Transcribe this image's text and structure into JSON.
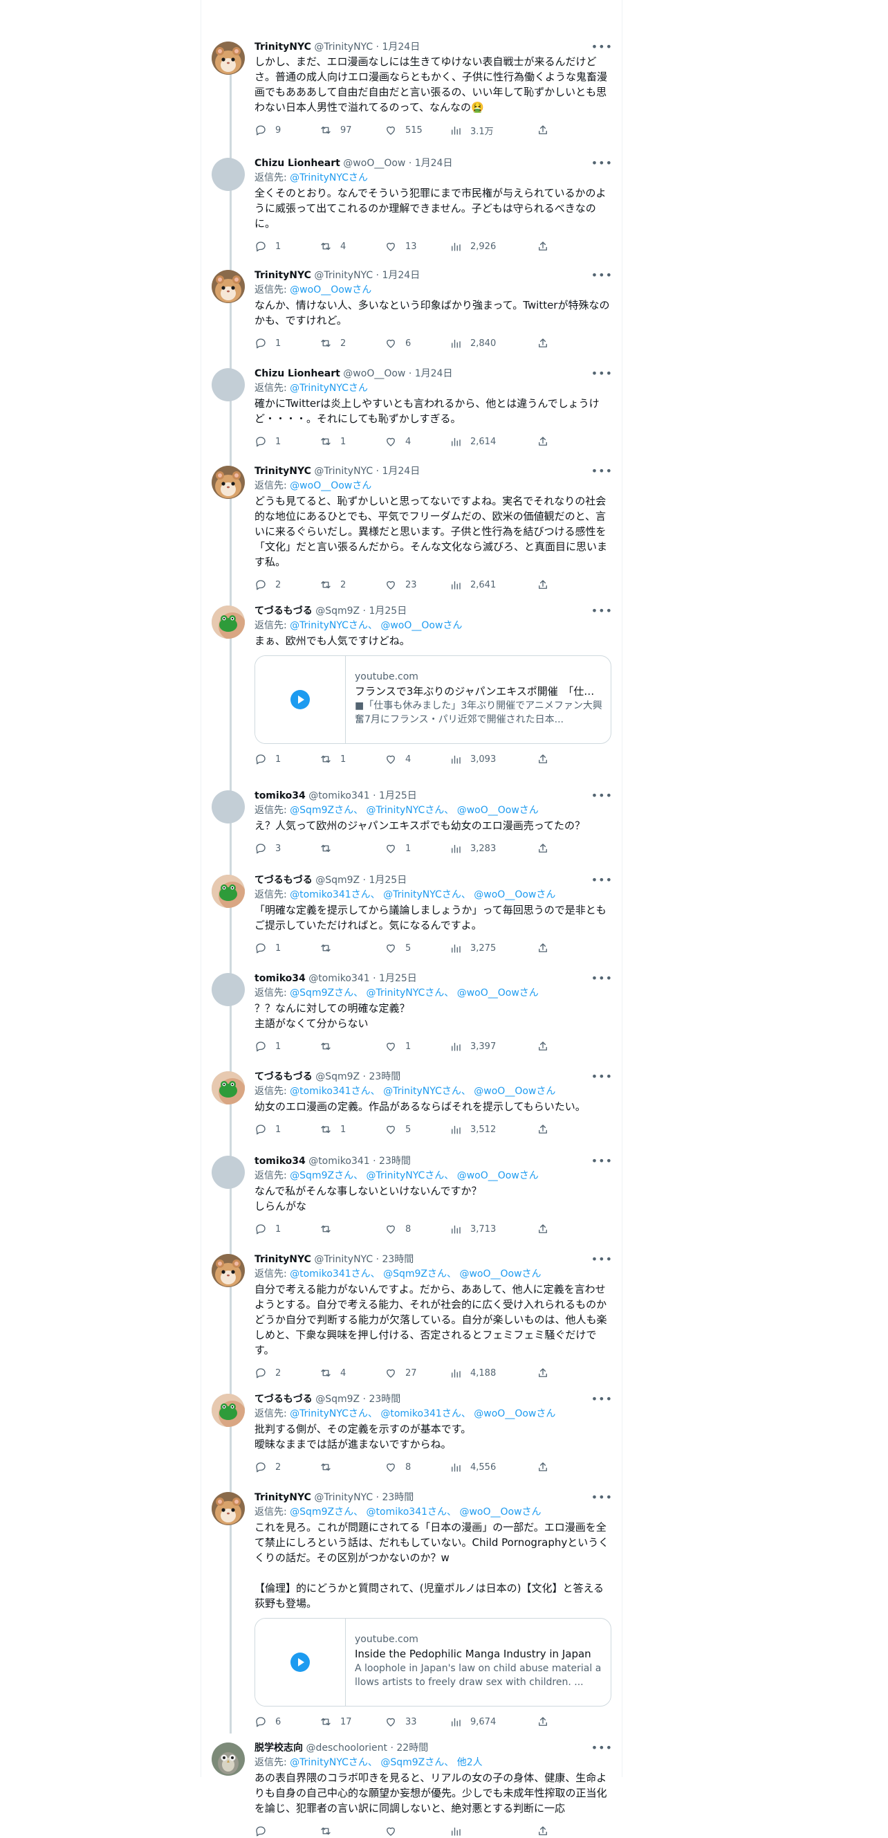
{
  "tweets": [
    {
      "name": "TrinityNYC",
      "handle": "@TrinityNYC",
      "time": "1月24日",
      "avatar": "hamster-avatar",
      "reply_to": [],
      "body": "しかし、まだ、エロ漫画なしには生きてゆけない表自戦士が来るんだけどさ。普通の成人向けエロ漫画ならともかく、子供に性行為働くような鬼畜漫画でもあああして自由だ自由だと言い張るの、いい年して恥ずかしいとも思わない日本人男性で溢れてるのって、なんなの🤮",
      "replies": "9",
      "retweets": "97",
      "likes": "515",
      "views": "3.1万"
    },
    {
      "name": "Chizu Lionheart",
      "handle": "@woO__Oow",
      "time": "1月24日",
      "avatar": "default-avatar",
      "reply_to": [
        "@TrinityNYCさん"
      ],
      "body": "全くそのとおり。なんでそういう犯罪にまで市民権が与えられているかのように威張って出てこれるのか理解できません。子どもは守られるべきなのに。",
      "replies": "1",
      "retweets": "4",
      "likes": "13",
      "views": "2,926"
    },
    {
      "name": "TrinityNYC",
      "handle": "@TrinityNYC",
      "time": "1月24日",
      "avatar": "hamster-avatar",
      "reply_to": [
        "@woO__Oowさん"
      ],
      "body": "なんか、情けない人、多いなという印象ばかり強まって。Twitterが特殊なのかも、ですけれど。",
      "replies": "1",
      "retweets": "2",
      "likes": "6",
      "views": "2,840"
    },
    {
      "name": "Chizu Lionheart",
      "handle": "@woO__Oow",
      "time": "1月24日",
      "avatar": "default-avatar",
      "reply_to": [
        "@TrinityNYCさん"
      ],
      "body": "確かにTwitterは炎上しやすいとも言われるから、他とは違うんでしょうけど・・・・。それにしても恥ずかしすぎる。",
      "replies": "1",
      "retweets": "1",
      "likes": "4",
      "views": "2,614"
    },
    {
      "name": "TrinityNYC",
      "handle": "@TrinityNYC",
      "time": "1月24日",
      "avatar": "hamster-avatar",
      "reply_to": [
        "@woO__Oowさん"
      ],
      "body": "どうも見てると、恥ずかしいと思ってないですよね。実名でそれなりの社会的な地位にあるひとでも、平気でフリーダムだの、欧米の価値観だのと、言いに来るぐらいだし。異様だと思います。子供と性行為を結びつける感性を「文化」だと言い張るんだから。そんな文化なら滅びろ、と真面目に思います私。",
      "replies": "2",
      "retweets": "2",
      "likes": "23",
      "views": "2,641"
    },
    {
      "name": "てづるもづる",
      "handle": "@Sqm9Z",
      "time": "1月25日",
      "avatar": "frog-avatar",
      "reply_to": [
        "@TrinityNYCさん、",
        "@woO__Oowさん"
      ],
      "body": "まぁ、欧州でも人気ですけどね。",
      "card": {
        "domain": "youtube.com",
        "title": "フランスで3年ぶりのジャパンエキスポ開催　「仕…",
        "desc": "■「仕事も休みました」3年ぶり開催でアニメファン大興奮7月にフランス・パリ近郊で開催された日本..."
      },
      "replies": "1",
      "retweets": "1",
      "likes": "4",
      "views": "3,093"
    },
    {
      "name": "tomiko34",
      "handle": "@tomiko341",
      "time": "1月25日",
      "avatar": "default-avatar",
      "reply_to": [
        "@Sqm9Zさん、",
        "@TrinityNYCさん、",
        "@woO__Oowさん"
      ],
      "body": "え？人気って欧州のジャパンエキスポでも幼女のエロ漫画売ってたの？",
      "replies": "3",
      "retweets": "",
      "likes": "1",
      "views": "3,283"
    },
    {
      "name": "てづるもづる",
      "handle": "@Sqm9Z",
      "time": "1月25日",
      "avatar": "frog-avatar",
      "reply_to": [
        "@tomiko341さん、",
        "@TrinityNYCさん、",
        "@woO__Oowさん"
      ],
      "body": "「明確な定義を提示してから議論しましょうか」って毎回思うので是非ともご提示していただければと。気になるんですよ。",
      "replies": "1",
      "retweets": "",
      "likes": "5",
      "views": "3,275"
    },
    {
      "name": "tomiko34",
      "handle": "@tomiko341",
      "time": "1月25日",
      "avatar": "default-avatar",
      "reply_to": [
        "@Sqm9Zさん、",
        "@TrinityNYCさん、",
        "@woO__Oowさん"
      ],
      "body": "？？なんに対しての明確な定義？\n主語がなくて分からない",
      "replies": "1",
      "retweets": "",
      "likes": "1",
      "views": "3,397"
    },
    {
      "name": "てづるもづる",
      "handle": "@Sqm9Z",
      "time": "23時間",
      "avatar": "frog-avatar",
      "reply_to": [
        "@tomiko341さん、",
        "@TrinityNYCさん、",
        "@woO__Oowさん"
      ],
      "body": "幼女のエロ漫画の定義。作品があるならばそれを提示してもらいたい。",
      "replies": "1",
      "retweets": "1",
      "likes": "5",
      "views": "3,512"
    },
    {
      "name": "tomiko34",
      "handle": "@tomiko341",
      "time": "23時間",
      "avatar": "default-avatar",
      "reply_to": [
        "@Sqm9Zさん、",
        "@TrinityNYCさん、",
        "@woO__Oowさん"
      ],
      "body": "なんで私がそんな事しないといけないんですか？\nしらんがな",
      "replies": "1",
      "retweets": "",
      "likes": "8",
      "views": "3,713"
    },
    {
      "name": "TrinityNYC",
      "handle": "@TrinityNYC",
      "time": "23時間",
      "avatar": "hamster-avatar",
      "reply_to": [
        "@tomiko341さん、",
        "@Sqm9Zさん、",
        "@woO__Oowさん"
      ],
      "body": "自分で考える能力がないんですよ。だから、ああして、他人に定義を言わせようとする。自分で考える能力、それが社会的に広く受け入れられるものかどうか自分で判断する能力が欠落している。自分が楽しいものは、他人も楽しめと、下衆な興味を押し付ける、否定されるとフェミフェミ騒ぐだけです。",
      "replies": "2",
      "retweets": "4",
      "likes": "27",
      "views": "4,188"
    },
    {
      "name": "てづるもづる",
      "handle": "@Sqm9Z",
      "time": "23時間",
      "avatar": "frog-avatar",
      "reply_to": [
        "@TrinityNYCさん、",
        "@tomiko341さん、",
        "@woO__Oowさん"
      ],
      "body": "批判する側が、その定義を示すのが基本です。\n曖昧なままでは話が進まないですからね。",
      "replies": "2",
      "retweets": "",
      "likes": "8",
      "views": "4,556"
    },
    {
      "name": "TrinityNYC",
      "handle": "@TrinityNYC",
      "time": "23時間",
      "avatar": "hamster-avatar",
      "reply_to": [
        "@Sqm9Zさん、",
        "@tomiko341さん、",
        "@woO__Oowさん"
      ],
      "body": "これを見ろ。これが問題にされてる「日本の漫画」の一部だ。エロ漫画を全て禁止にしろという話は、だれもしていない。Child Pornographyというくくりの話だ。その区別がつかないのか？w\n\n【倫理】的にどうかと質問されて、(児童ポルノは日本の)【文化】と答える荻野も登場。",
      "card": {
        "domain": "youtube.com",
        "title": "Inside the Pedophilic Manga Industry in Japan",
        "desc": "A loophole in Japan's law on child abuse material allows artists to freely draw sex with children. ..."
      },
      "replies": "6",
      "retweets": "17",
      "likes": "33",
      "views": "9,674"
    },
    {
      "name": "脱学校志向",
      "handle": "@deschoolorient",
      "time": "22時間",
      "avatar": "owl-avatar",
      "reply_to": [
        "@TrinityNYCさん、",
        "@Sqm9Zさん、",
        "他2人"
      ],
      "body": "あの表自界隈のコラボ叩きを見ると、リアルの女の子の身体、健康、生命よりも自身の自己中心的な願望か妄想が優先。少しでも未成年性搾取の正当化を論じ、犯罪者の言い訳に同調しないと、絶対悪とする判断に一応",
      "replies": "",
      "retweets": "",
      "likes": "",
      "views": ""
    }
  ]
}
